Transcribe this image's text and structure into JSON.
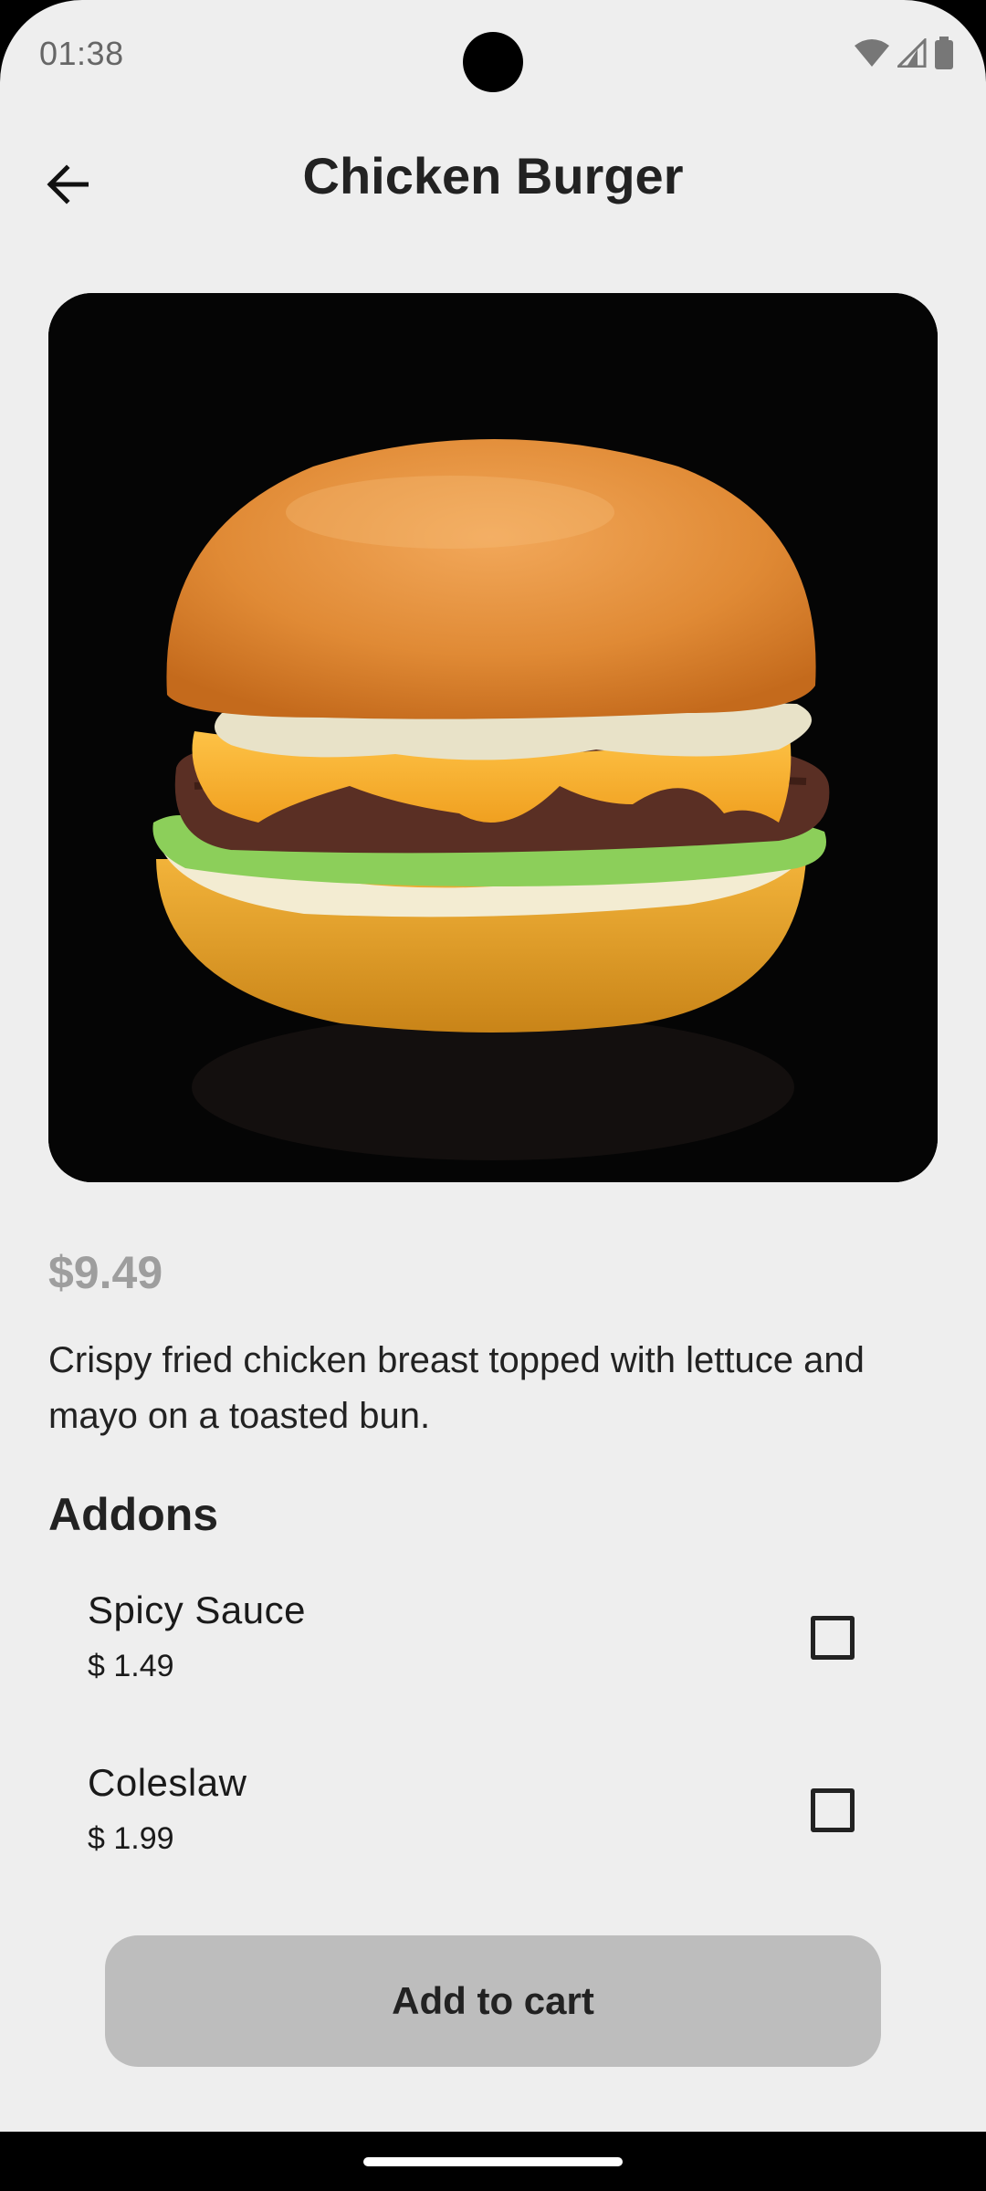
{
  "status_bar": {
    "time": "01:38",
    "icons": [
      "wifi-icon",
      "signal-icon",
      "battery-icon"
    ]
  },
  "app_bar": {
    "back_icon": "arrow-left-icon",
    "title": "Chicken Burger"
  },
  "product": {
    "image_subject": "burger",
    "price": "$9.49",
    "description": "Crispy fried chicken breast topped with lettuce and mayo on a toasted bun."
  },
  "addons": {
    "heading": "Addons",
    "items": [
      {
        "name": "Spicy Sauce",
        "price": "$ 1.49",
        "checked": false
      },
      {
        "name": "Coleslaw",
        "price": "$ 1.99",
        "checked": false
      }
    ]
  },
  "cart_button": {
    "label": "Add to cart"
  },
  "colors": {
    "background": "#eeeeee",
    "price_text": "#9e9e9e",
    "button_bg": "#bdbdbd",
    "text": "#222222"
  }
}
